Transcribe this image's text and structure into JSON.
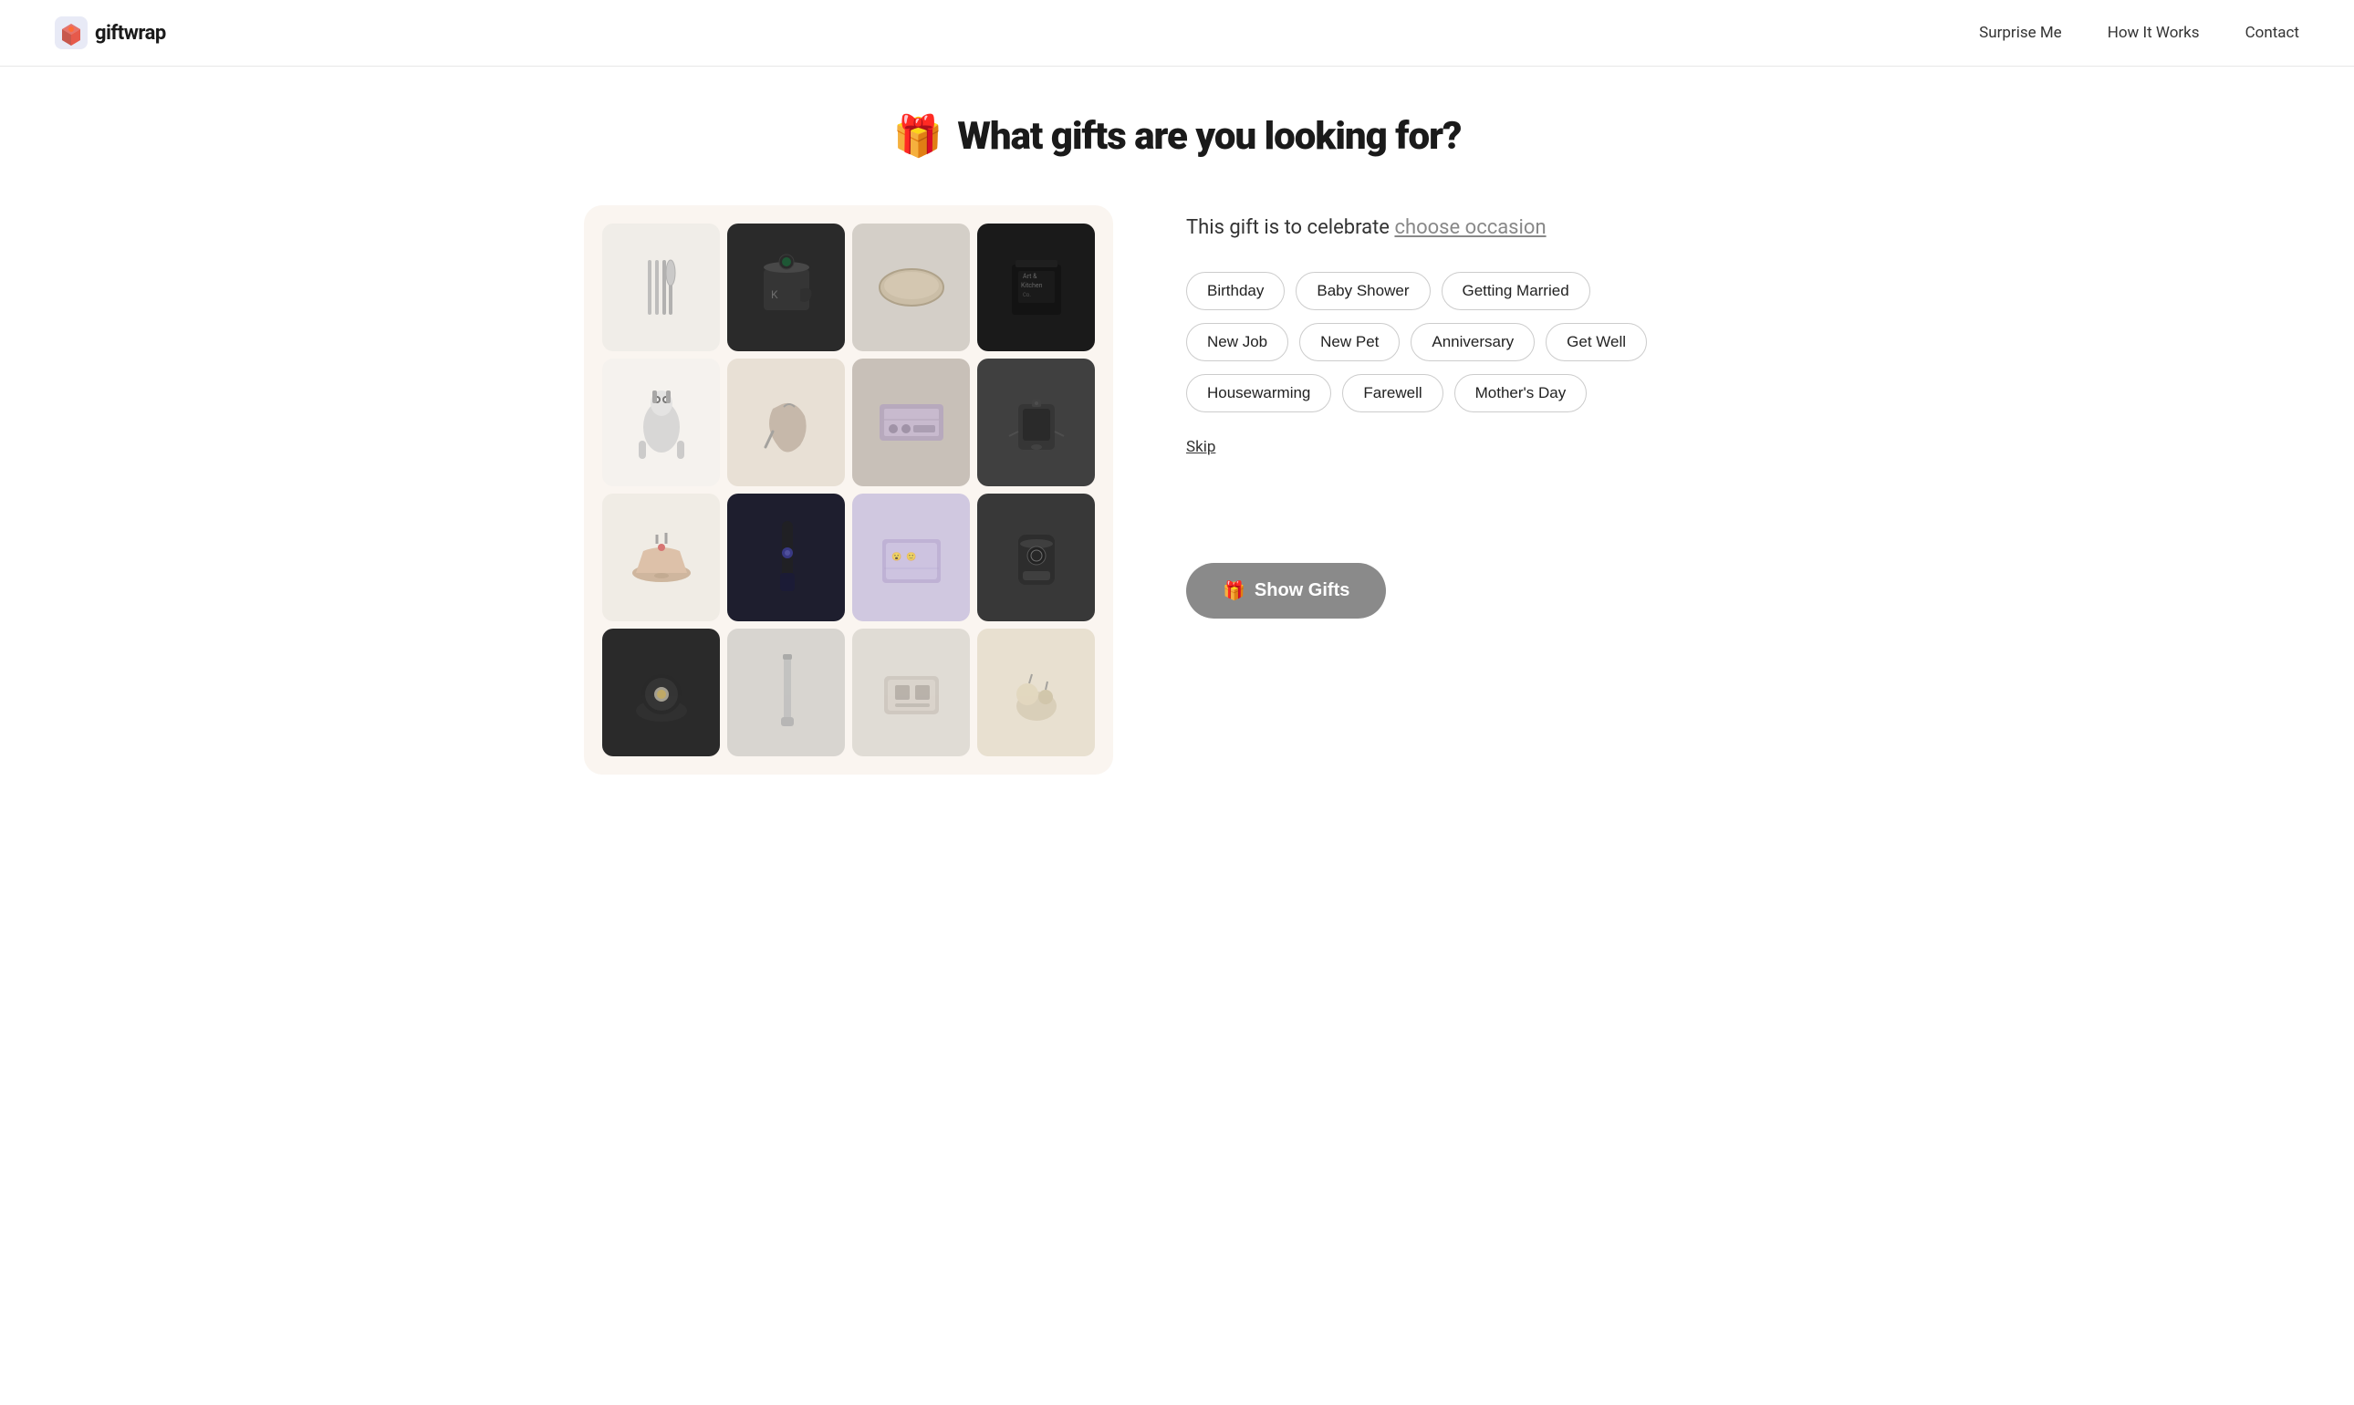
{
  "header": {
    "logo_text": "giftwrap",
    "nav_items": [
      {
        "label": "Surprise Me",
        "id": "surprise-me"
      },
      {
        "label": "How It Works",
        "id": "how-it-works"
      },
      {
        "label": "Contact",
        "id": "contact"
      }
    ]
  },
  "hero": {
    "emoji": "🎁",
    "title": "What gifts are you looking for?"
  },
  "occasion_section": {
    "prompt_text": "This gift is to celebrate",
    "prompt_link": "choose occasion",
    "tags_rows": [
      [
        {
          "label": "Birthday",
          "id": "birthday"
        },
        {
          "label": "Baby Shower",
          "id": "baby-shower"
        },
        {
          "label": "Getting Married",
          "id": "getting-married"
        }
      ],
      [
        {
          "label": "New Job",
          "id": "new-job"
        },
        {
          "label": "New Pet",
          "id": "new-pet"
        },
        {
          "label": "Anniversary",
          "id": "anniversary"
        },
        {
          "label": "Get Well",
          "id": "get-well"
        }
      ],
      [
        {
          "label": "Housewarming",
          "id": "housewarming"
        },
        {
          "label": "Farewell",
          "id": "farewell"
        },
        {
          "label": "Mother's Day",
          "id": "mothers-day"
        }
      ]
    ],
    "skip_label": "Skip",
    "show_gifts_emoji": "🎁",
    "show_gifts_label": "Show Gifts"
  },
  "image_grid": {
    "cells": [
      {
        "bg": "#f0ede8",
        "icon": "🍴",
        "row": 1,
        "col": 1
      },
      {
        "bg": "#2a2a2a",
        "icon": "☕",
        "row": 1,
        "col": 2
      },
      {
        "bg": "#d4cfc8",
        "icon": "🍽️",
        "row": 1,
        "col": 3
      },
      {
        "bg": "#1a1a1a",
        "icon": "🛒",
        "row": 1,
        "col": 4
      },
      {
        "bg": "#f5f2ee",
        "icon": "🐧",
        "row": 2,
        "col": 1
      },
      {
        "bg": "#e8e0d5",
        "icon": "👜",
        "row": 2,
        "col": 2
      },
      {
        "bg": "#c8c0b8",
        "icon": "🎮",
        "row": 2,
        "col": 3
      },
      {
        "bg": "#404040",
        "icon": "🎒",
        "row": 2,
        "col": 4
      },
      {
        "bg": "#f0ece5",
        "icon": "🍳",
        "row": 3,
        "col": 1
      },
      {
        "bg": "#1e1e2e",
        "icon": "☕",
        "row": 3,
        "col": 2
      },
      {
        "bg": "#d0c8e0",
        "icon": "🎨",
        "row": 3,
        "col": 3
      },
      {
        "bg": "#383838",
        "icon": "🔊",
        "row": 3,
        "col": 4
      },
      {
        "bg": "#2a2a2a",
        "icon": "💡",
        "row": 4,
        "col": 1
      },
      {
        "bg": "#d8d5d0",
        "icon": "🕯️",
        "row": 4,
        "col": 2
      },
      {
        "bg": "#e0dcd5",
        "icon": "🖥️",
        "row": 4,
        "col": 3
      },
      {
        "bg": "#e8e0d0",
        "icon": "🧸",
        "row": 4,
        "col": 4
      }
    ]
  }
}
